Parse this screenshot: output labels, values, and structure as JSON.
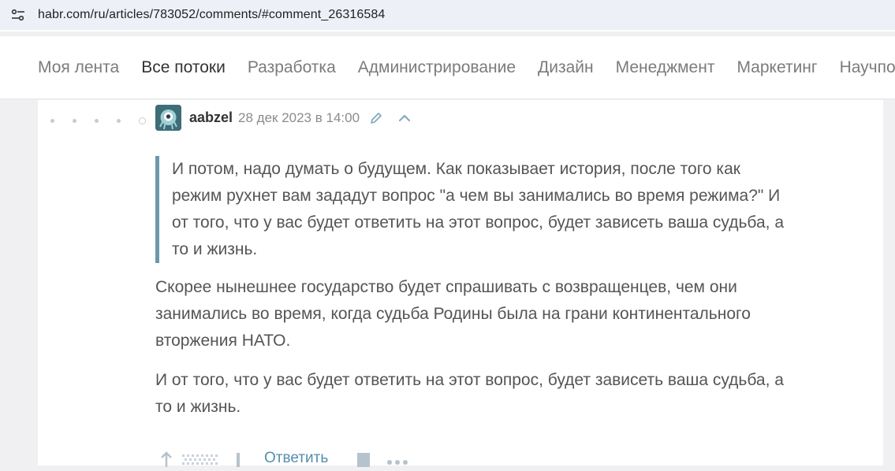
{
  "browser": {
    "url": "habr.com/ru/articles/783052/comments/#comment_26316584"
  },
  "nav": {
    "items": [
      {
        "label": "Моя лента",
        "active": false
      },
      {
        "label": "Все потоки",
        "active": true
      },
      {
        "label": "Разработка",
        "active": false
      },
      {
        "label": "Администрирование",
        "active": false
      },
      {
        "label": "Дизайн",
        "active": false
      },
      {
        "label": "Менеджмент",
        "active": false
      },
      {
        "label": "Маркетинг",
        "active": false
      },
      {
        "label": "Научпоп",
        "active": false
      }
    ]
  },
  "comment": {
    "username": "aabzel",
    "time": "28 дек 2023 в 14:00",
    "quote": "И потом, надо думать о будущем. Как показывает история, после того как\nрежим рухнет вам зададут вопрос \"а чем вы занимались во время режима?\" И\nот того, что у вас будет ответить на этот вопрос, будет зависеть ваша судьба, а\nто и жизнь.",
    "paragraph1": "Скорее нынешнее государство будет спрашивать с возвращенцев, чем они\nзанимались во время, когда судьба Родины была на грани континентального\nвторжения НАТО.",
    "paragraph2": "И от того, что у вас будет ответить на этот вопрос, будет зависеть ваша судьба, а\nто и жизнь.",
    "reply_label": "Ответить"
  },
  "colors": {
    "accent": "#548eaa",
    "quote_border": "#6d98ad"
  }
}
